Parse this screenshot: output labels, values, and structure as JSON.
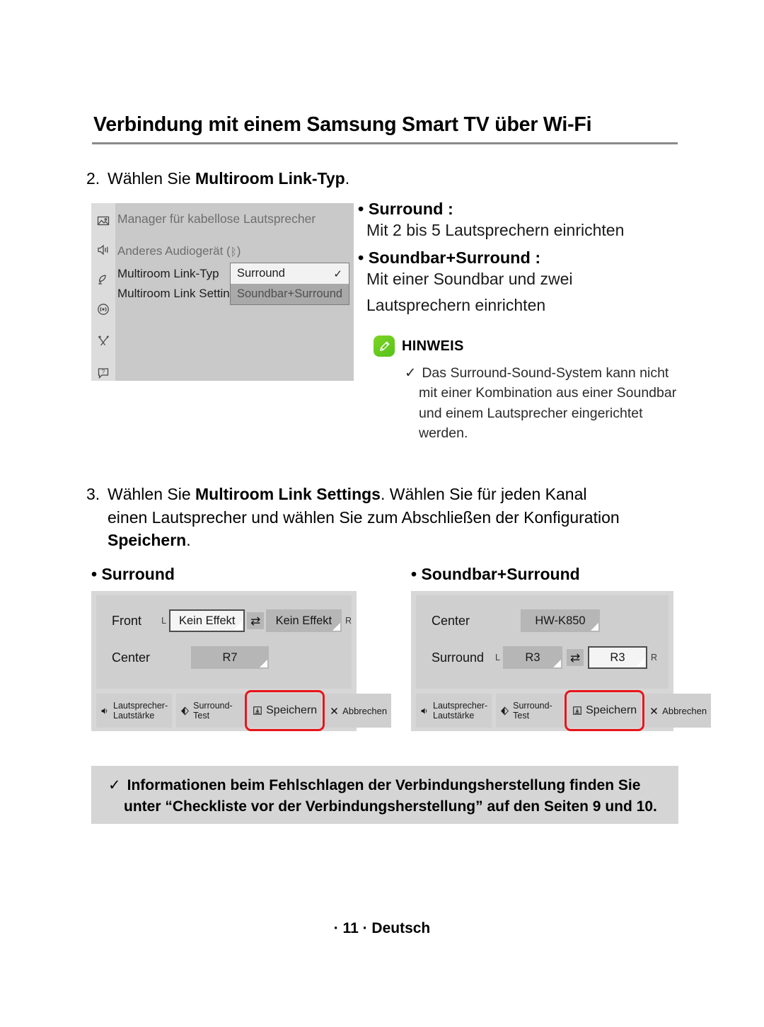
{
  "header": {
    "title": "Verbindung mit einem Samsung Smart TV über Wi-Fi"
  },
  "step2": {
    "number": "2.",
    "text_before": "Wählen Sie ",
    "bold": "Multiroom Link-Typ",
    "text_after": "."
  },
  "tv_menu": {
    "title": "Manager für kabellose Lautsprecher",
    "rail_icons": [
      "picture-icon",
      "sound-icon",
      "satellite-dish-icon",
      "broadcast-icon",
      "tools-icon",
      "support-icon"
    ],
    "rows": [
      {
        "label": "Anderes Audiogerät (",
        "bt": "bluetooth-icon",
        "label_end": ")"
      },
      {
        "label": "Multiroom Link-Typ"
      },
      {
        "label": "Multiroom Link Settings"
      }
    ],
    "dropdown": {
      "selected": "Surround",
      "check": "✓",
      "other": "Soundbar+Surround"
    }
  },
  "options": {
    "bullet1_title": "• Surround :",
    "bullet1_desc": "Mit 2 bis 5 Lautsprechern einrichten",
    "bullet2_title": "• Soundbar+Surround :",
    "bullet2_desc_line1": "Mit einer Soundbar und zwei",
    "bullet2_desc_line2": "Lautsprechern einrichten"
  },
  "note": {
    "icon": "pencil-note-icon",
    "icon_color": "#63c91e",
    "label": "HINWEIS",
    "tick": "✓",
    "text": "Das Surround-Sound-System kann nicht mit einer Kombination aus einer Soundbar und einem Lautsprecher eingerichtet werden."
  },
  "step3": {
    "number": "3.",
    "line1_a": "Wählen Sie ",
    "line1_bold": "Multiroom Link Settings",
    "line1_b": ". Wählen Sie für jeden Kanal",
    "line2": "einen Lautsprecher und wählen Sie zum Abschließen der Konfiguration",
    "line3_bold": "Speichern",
    "line3_b": "."
  },
  "panels": [
    {
      "title": "• Surround",
      "rows": [
        {
          "label": "Front",
          "left_mark": "L",
          "left_value": "Kein Effekt",
          "left_state": "focus",
          "swap": "⇄",
          "right_value": "Kein Effekt",
          "right_state": "plain",
          "right_mark": "R"
        },
        {
          "label": "Center",
          "value": "R7",
          "state": "plain"
        }
      ],
      "buttons": [
        {
          "icon": "speaker-volume-icon",
          "label": "Lautsprecher-\nLautstärke",
          "highlight": false
        },
        {
          "icon": "surround-test-icon",
          "label": "Surround-Test",
          "highlight": false
        },
        {
          "icon": "save-icon",
          "label": "Speichern",
          "highlight": true
        },
        {
          "icon": "cancel-x-icon",
          "label": "Abbrechen",
          "highlight": false
        }
      ]
    },
    {
      "title": "• Soundbar+Surround",
      "rows": [
        {
          "label": "Center",
          "value": "HW-K850",
          "state": "plain"
        },
        {
          "label": "Surround",
          "left_mark": "L",
          "left_value": "R3",
          "left_state": "plain",
          "swap": "⇄",
          "right_value": "R3",
          "right_state": "focus",
          "right_mark": "R"
        }
      ],
      "buttons": [
        {
          "icon": "speaker-volume-icon",
          "label": "Lautsprecher-\nLautstärke",
          "highlight": false
        },
        {
          "icon": "surround-test-icon",
          "label": "Surround-Test",
          "highlight": false
        },
        {
          "icon": "save-icon",
          "label": "Speichern",
          "highlight": true
        },
        {
          "icon": "cancel-x-icon",
          "label": "Abbrechen",
          "highlight": false
        }
      ]
    }
  ],
  "infobox": {
    "tick": "✓",
    "line1": "Informationen beim Fehlschlagen der Verbindungsherstellung finden Sie",
    "line2": "unter “Checkliste vor der Verbindungsherstellung” auf den Seiten 9 und 10."
  },
  "footer": {
    "text": "· 11 · Deutsch"
  },
  "colors": {
    "highlight_red": "#e8141b",
    "note_green": "#63c91e",
    "panel_bg": "#d7d7d7",
    "rule_gray": "#8a8a8a"
  }
}
